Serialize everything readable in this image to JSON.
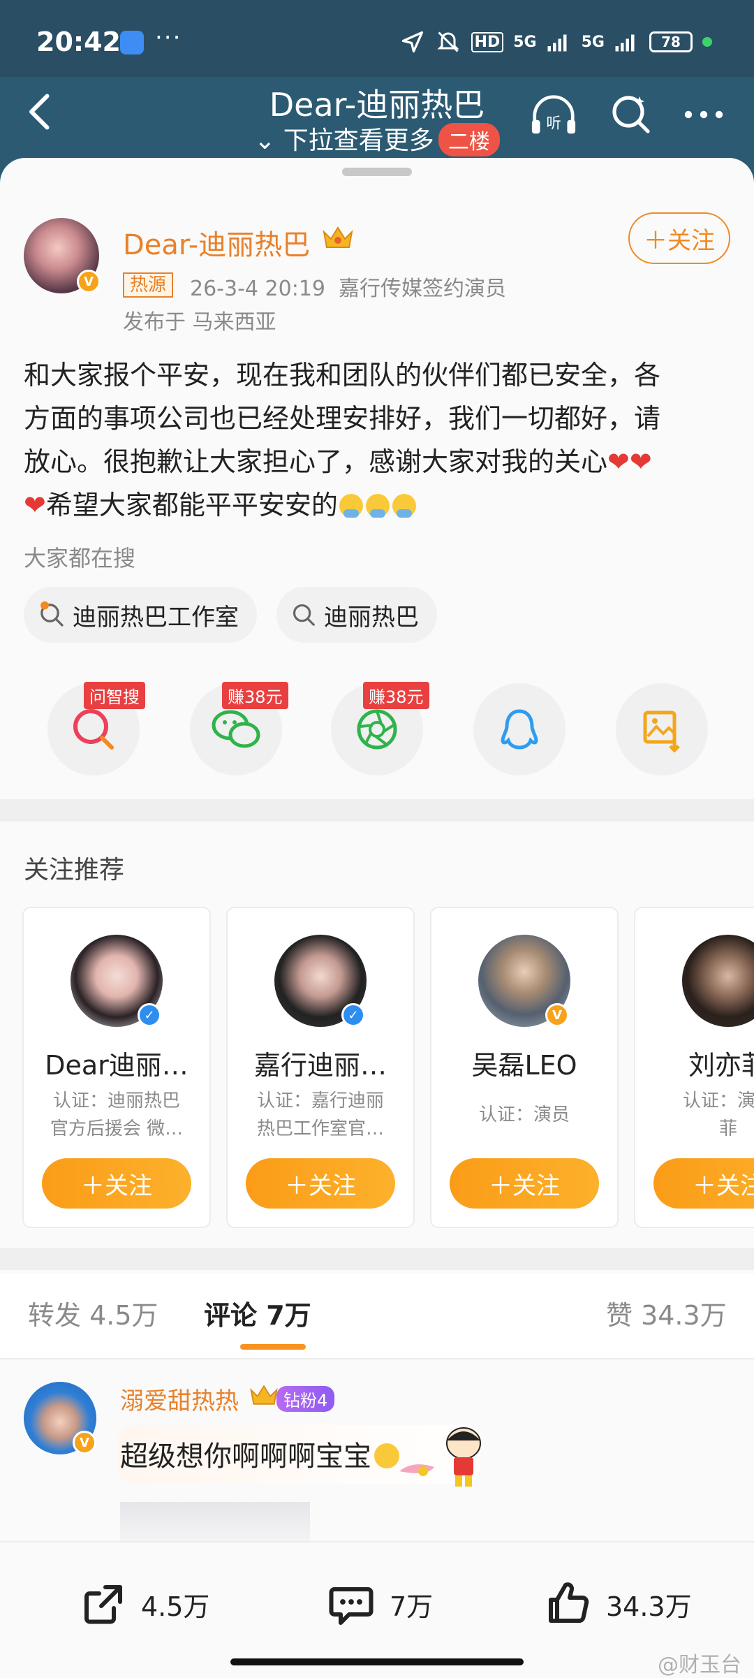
{
  "status_bar": {
    "time": "20:42",
    "dots": "···",
    "network_1": "5G",
    "network_2": "5G",
    "hd_label": "HD",
    "battery": "78"
  },
  "nav": {
    "title": "Dear-迪丽热巴",
    "subtitle": "下拉查看更多",
    "floor_tag": "二楼",
    "listen_label": "听"
  },
  "post": {
    "author": "Dear-迪丽热巴",
    "follow_label": "＋关注",
    "hot_tag": "热源",
    "meta": "26-3-4 20:19  嘉行传媒签约演员",
    "location": "发布于 马来西亚",
    "content_line_1": "和大家报个平安，现在我和团队的伙伴们都已安全，各",
    "content_line_2": "方面的事项公司也已经处理安排好，我们一切都好，请",
    "content_line_3": "放心。很抱歉让大家担心了，感谢大家对我的关心",
    "content_line_4": "希望大家都能平平安安的"
  },
  "search": {
    "label": "大家都在搜",
    "chips": [
      "迪丽热巴工作室",
      "迪丽热巴"
    ]
  },
  "share": {
    "badges": [
      "问智搜",
      "赚38元",
      "赚38元"
    ],
    "icons": [
      "smart-search-icon",
      "wechat-icon",
      "moments-icon",
      "qq-icon",
      "save-image-icon"
    ]
  },
  "recommend": {
    "title": "关注推荐",
    "cards": [
      {
        "name": "Dear迪丽…",
        "desc_1": "认证：迪丽热巴",
        "desc_2": "官方后援会 微…",
        "button": "＋关注"
      },
      {
        "name": "嘉行迪丽…",
        "desc_1": "认证：嘉行迪丽",
        "desc_2": "热巴工作室官…",
        "button": "＋关注"
      },
      {
        "name": "吴磊LEO",
        "desc_1": "认证：演员",
        "desc_2": "",
        "button": "＋关注"
      },
      {
        "name": "刘亦菲",
        "desc_1": "认证：演员",
        "desc_2": "菲",
        "button": "＋关注"
      }
    ]
  },
  "tabs": {
    "repost": "转发 4.5万",
    "comment": "评论 7万",
    "like": "赞 34.3万"
  },
  "comment": {
    "user": "溺爱甜热热",
    "fan_badge": "钻粉4",
    "text": "超级想你啊啊啊宝宝"
  },
  "bottom": {
    "repost": "4.5万",
    "comment": "7万",
    "like": "34.3万",
    "watermark": "@财玉台"
  },
  "colors": {
    "accent": "#f08a23",
    "header_bg": "#2b5a72",
    "red": "#e84040"
  }
}
